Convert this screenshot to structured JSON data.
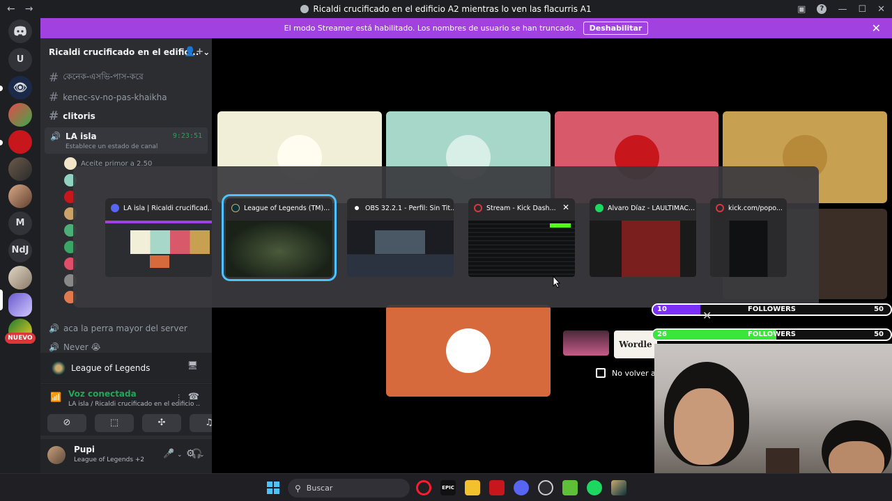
{
  "titlebar": {
    "title": "Ricaldi crucificado en el edificio A2 mientras lo ven las flacurris A1",
    "back": "←",
    "forward": "→",
    "minimize": "—",
    "maximize": "☐",
    "close": "✕"
  },
  "banner": {
    "text": "El modo Streamer está habilitado. Los nombres de usuario se han truncado.",
    "button": "Deshabilitar"
  },
  "rail": {
    "servers": [
      "U",
      "M",
      "NdJ"
    ],
    "new_badge": "NUEVO"
  },
  "server": {
    "name": "Ricaldi crucificado en el edific...",
    "channels": [
      {
        "name": "কেনেক-এসভি-পাস-করে"
      },
      {
        "name": "kenec-sv-no-pas-khaikha"
      },
      {
        "name": "clitoris"
      }
    ],
    "voice_channel": {
      "name": "LA isla",
      "timer": "9:23:51",
      "status": "Establece un estado de canal",
      "first_user_text": "Aceite primor a 2.50"
    },
    "other_voice": [
      {
        "name": "aca la perra mayor del server"
      },
      {
        "name": "Never 😭"
      }
    ]
  },
  "activity": {
    "game": "League of Legends"
  },
  "voice_connected": {
    "title": "Voz conectada",
    "subtitle": "LA isla / Ricaldi crucificado en el edificio ..."
  },
  "user": {
    "name": "Pupi",
    "game": "League of Legends +2"
  },
  "switcher": {
    "windows": [
      {
        "title": "LA isla | Ricaldi crucificad..."
      },
      {
        "title": "League of Legends (TM)..."
      },
      {
        "title": "OBS 32.2.1 - Perfil: Sin Tit..."
      },
      {
        "title": "Stream - Kick Dash..."
      },
      {
        "title": "Alvaro Díaz - LAULTIMAC..."
      },
      {
        "title": "kick.com/popo..."
      }
    ],
    "selected_index": 1
  },
  "followers": [
    {
      "value": "10",
      "label": "FOLLOWERS",
      "goal": "50",
      "progress": 0.2
    },
    {
      "value": "26",
      "label": "FOLLOWERS",
      "goal": "50",
      "progress": 0.52
    }
  ],
  "stage": {
    "wordle": "Wordle",
    "no_volver": "No volver a m"
  },
  "taskbar": {
    "search": "Buscar"
  },
  "colors": {
    "accent_streamer": "#a142e0",
    "discord_green": "#23a55a",
    "selection_outline": "#4cc2ff",
    "followers_fill_1": "#7b2ff7",
    "followers_fill_2": "#39e63a"
  }
}
